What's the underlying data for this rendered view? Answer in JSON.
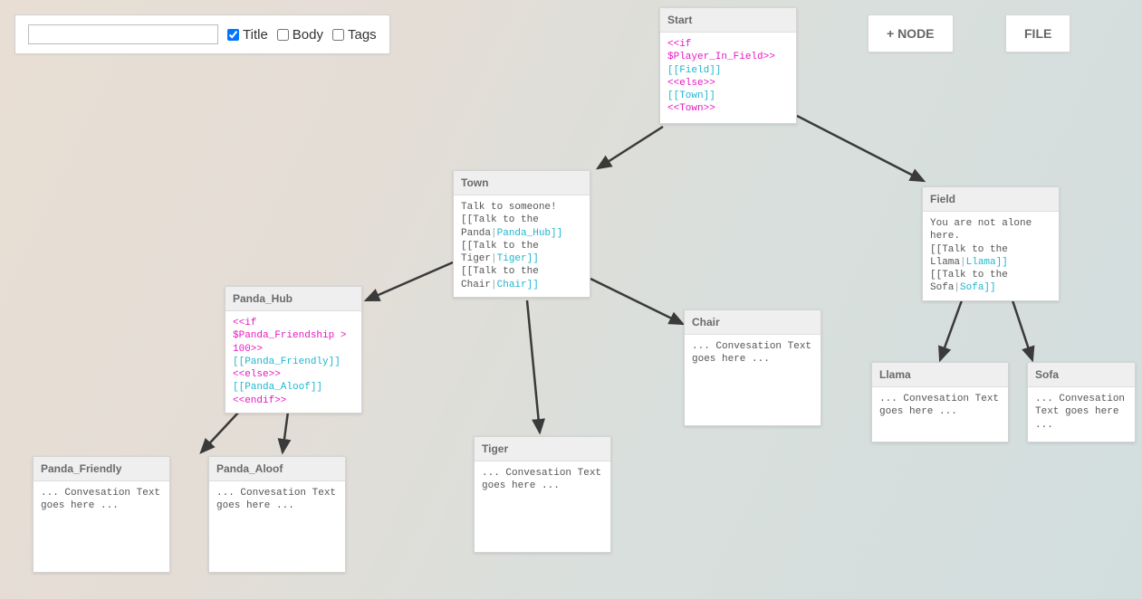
{
  "toolbar": {
    "search_placeholder": "",
    "filter_title": "Title",
    "filter_body": "Body",
    "filter_tags": "Tags"
  },
  "buttons": {
    "add_node": "+ NODE",
    "file": "FILE"
  },
  "nodes": {
    "start": {
      "title": "Start",
      "code": {
        "l1": "<<if $Player_In_Field>>",
        "l2": "[[Field]]",
        "l3": "<<else>>",
        "l4": "[[Town]]",
        "l5": "<<Town>>"
      }
    },
    "town": {
      "title": "Town",
      "intro": "Talk to someone!",
      "opt1_pre": "[[Talk to the Panda",
      "opt1_link": "Panda_Hub]]",
      "opt2_pre": "[[Talk to the Tiger",
      "opt2_link": "Tiger]]",
      "opt3_pre": "[[Talk to the Chair",
      "opt3_link": "Chair]]"
    },
    "field": {
      "title": "Field",
      "intro": "You are not alone here.",
      "opt1_pre": "[[Talk to the Llama",
      "opt1_link": "Llama]]",
      "opt2_pre": "[[Talk to the Sofa",
      "opt2_link": "Sofa]]"
    },
    "panda_hub": {
      "title": "Panda_Hub",
      "l1": "<<if $Panda_Friendship > 100>>",
      "l2": "[[Panda_Friendly]]",
      "l3": "<<else>>",
      "l4": "[[Panda_Aloof]]",
      "l5": "<<endif>>"
    },
    "chair": {
      "title": "Chair",
      "body": "... Convesation Text goes here ..."
    },
    "tiger": {
      "title": "Tiger",
      "body": "... Convesation Text goes here ..."
    },
    "llama": {
      "title": "Llama",
      "body": "... Convesation Text goes here ..."
    },
    "sofa": {
      "title": "Sofa",
      "body": "... Convesation Text goes here ..."
    },
    "panda_friendly": {
      "title": "Panda_Friendly",
      "body": "... Convesation Text goes here ..."
    },
    "panda_aloof": {
      "title": "Panda_Aloof",
      "body": "... Convesation Text goes here ..."
    }
  },
  "edges": [
    {
      "from": "start",
      "to": "town"
    },
    {
      "from": "start",
      "to": "field"
    },
    {
      "from": "town",
      "to": "panda_hub"
    },
    {
      "from": "town",
      "to": "tiger"
    },
    {
      "from": "town",
      "to": "chair"
    },
    {
      "from": "field",
      "to": "llama"
    },
    {
      "from": "field",
      "to": "sofa"
    },
    {
      "from": "panda_hub",
      "to": "panda_friendly"
    },
    {
      "from": "panda_hub",
      "to": "panda_aloof"
    }
  ]
}
